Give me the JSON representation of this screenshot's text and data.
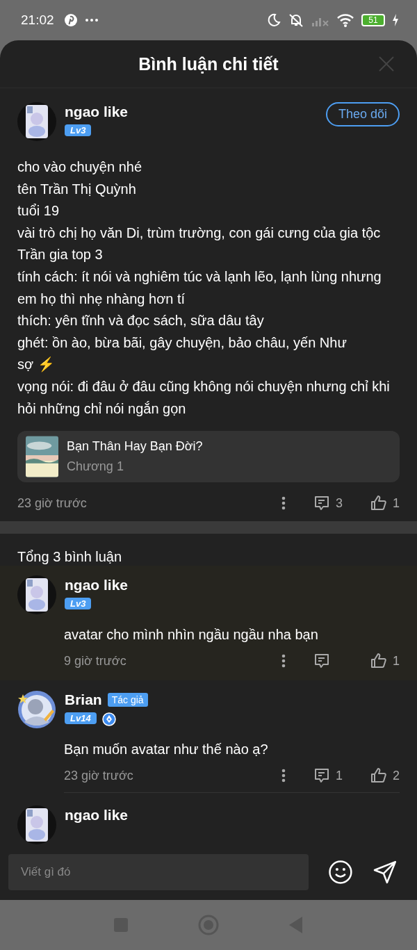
{
  "status_bar": {
    "time": "21:02",
    "battery": "51"
  },
  "header": {
    "title": "Bình luận chi tiết"
  },
  "post": {
    "author": "ngao like",
    "level": "Lv3",
    "follow_button": "Theo dõi",
    "lines": [
      "cho vào chuyện nhé",
      "tên Trần Thị Quỳnh",
      "tuổi 19",
      "vài trò chị họ văn Di, trùm trường, con gái cưng của gia tộc Trần gia top 3",
      "tính cách: ít nói và nghiêm túc và lạnh lẽo, lạnh lùng nhưng em họ thì nhẹ nhàng hơn tí",
      "thích: yên tĩnh và đọc sách, sữa dâu tây",
      "ghét: ồn ào, bừa bãi, gây chuyện, bảo châu, yến Như",
      "sợ ⚡",
      "vọng nói: đi đâu ở đâu cũng không nói chuyện nhưng chỉ khi hỏi những chỉ nói ngắn gọn"
    ],
    "story": {
      "title": "Bạn Thân Hay Bạn Đời?",
      "chapter": "Chương 1"
    },
    "time": "23 giờ trước",
    "replies": "3",
    "likes": "1"
  },
  "comments_total": "Tổng 3 bình luận",
  "comments": [
    {
      "author": "ngao like",
      "level": "Lv3",
      "highlighted": true,
      "text": "avatar cho mình nhìn ngầu ngầu nha bạn",
      "time": "9 giờ trước",
      "likes": "1"
    },
    {
      "author": "Brian",
      "author_badge": "Tác giả",
      "level": "Lv14",
      "writer": true,
      "highlighted": false,
      "text": "Bạn muốn avatar như thế nào ạ?",
      "time": "23 giờ trước",
      "replies": "1",
      "likes": "2"
    },
    {
      "author": "ngao like",
      "highlighted": false
    }
  ],
  "input": {
    "placeholder": "Viết gì đó"
  }
}
